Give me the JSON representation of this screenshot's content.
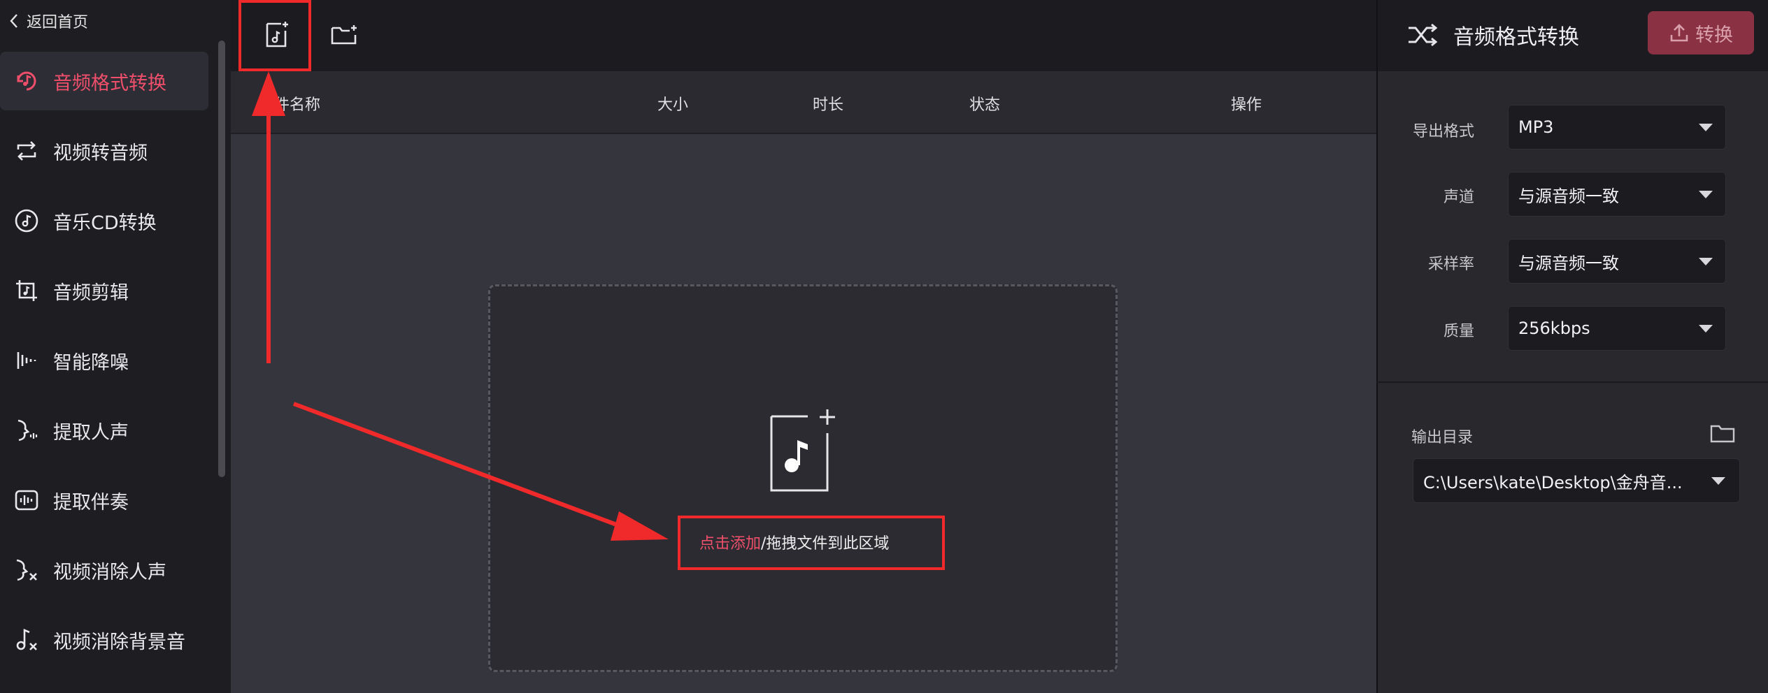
{
  "sidebar": {
    "back_label": "返回首页",
    "items": [
      {
        "label": "音频格式转换",
        "icon": "audio-convert-icon",
        "active": true
      },
      {
        "label": "视频转音频",
        "icon": "loop-arrows-icon",
        "active": false
      },
      {
        "label": "音乐CD转换",
        "icon": "cd-icon",
        "active": false
      },
      {
        "label": "音频剪辑",
        "icon": "audio-trim-icon",
        "active": false
      },
      {
        "label": "智能降噪",
        "icon": "waveform-icon",
        "active": false
      },
      {
        "label": "提取人声",
        "icon": "voice-face-icon",
        "active": false
      },
      {
        "label": "提取伴奏",
        "icon": "accompaniment-icon",
        "active": false
      },
      {
        "label": "视频消除人声",
        "icon": "voice-remove-icon",
        "active": false
      },
      {
        "label": "视频消除背景音",
        "icon": "music-remove-icon",
        "active": false
      }
    ]
  },
  "toolbar": {
    "add_file_icon": "add-music-file-icon",
    "add_folder_icon": "add-folder-icon"
  },
  "table": {
    "columns": [
      "文件名称",
      "大小",
      "时长",
      "状态",
      "操作"
    ]
  },
  "dropzone": {
    "icon": "music-file-plus-icon",
    "link_text": "点击添加",
    "rest_text": "/拖拽文件到此区域"
  },
  "right_panel": {
    "title": "音频格式转换",
    "title_icon": "shuffle-icon",
    "convert_label": "转换",
    "fields": [
      {
        "label": "导出格式",
        "value": "MP3"
      },
      {
        "label": "声道",
        "value": "与源音频一致"
      },
      {
        "label": "采样率",
        "value": "与源音频一致"
      },
      {
        "label": "质量",
        "value": "256kbps"
      }
    ],
    "output_label": "输出目录",
    "output_path": "C:\\Users\\kate\\Desktop\\金舟音..."
  },
  "colors": {
    "accent": "#ef4f6b",
    "annotation": "#f02a2a",
    "convert_bg": "#8a3144"
  }
}
